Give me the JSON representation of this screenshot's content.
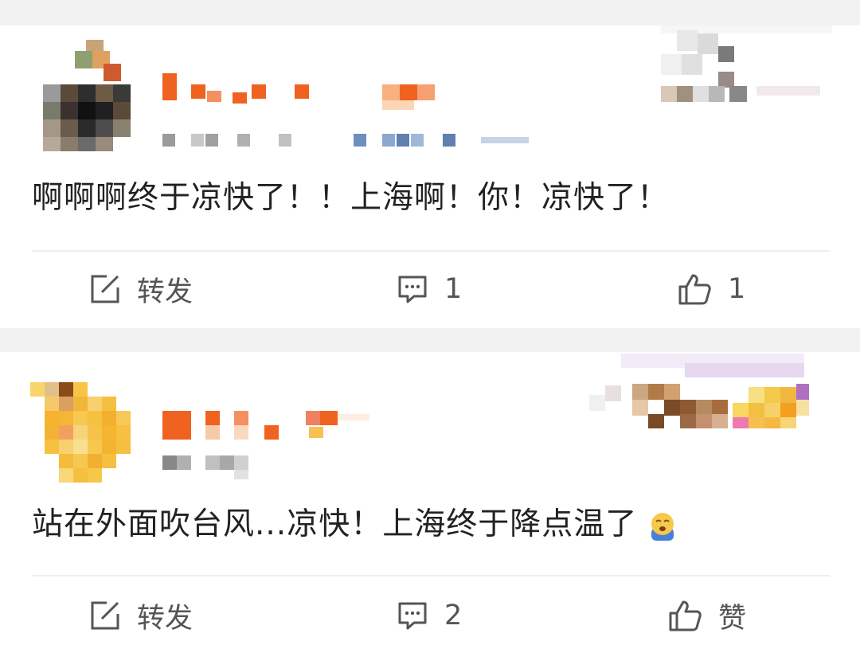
{
  "posts": [
    {
      "text": "啊啊啊终于凉快了！！上海啊！你！凉快了！",
      "actions": {
        "repost_label": "转发",
        "comment_count": "1",
        "like_count": "1"
      }
    },
    {
      "text": "站在外面吹台风...凉快！上海终于降点温了",
      "emoji": "yawn-face-emoji",
      "actions": {
        "repost_label": "转发",
        "comment_count": "2",
        "like_label": "赞"
      }
    }
  ],
  "colors": {
    "text": "#222222",
    "action": "#555555",
    "divider": "#eeeeee",
    "separator": "#f2f2f2",
    "accent": "#f0621f"
  },
  "icons": [
    "edit-share-icon",
    "comment-icon",
    "thumbs-up-icon"
  ]
}
